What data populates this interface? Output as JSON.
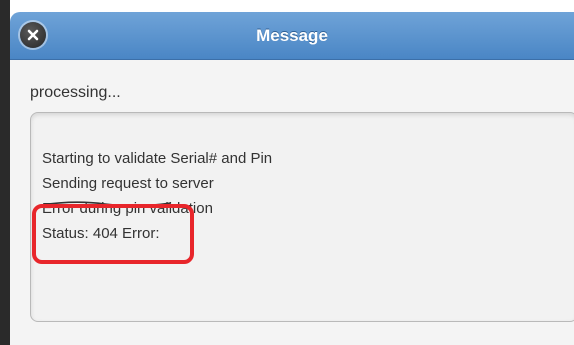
{
  "dialog": {
    "title": "Message",
    "close_icon": "close-icon",
    "status_text": "processing..."
  },
  "log": {
    "lines": [
      "Starting to validate Serial# and Pin",
      "Sending request to server",
      "Error during pin validation",
      "Status: 404 Error:"
    ]
  },
  "colors": {
    "titlebar": "#4a86c5",
    "highlight": "#e8262b",
    "text": "#333333"
  }
}
